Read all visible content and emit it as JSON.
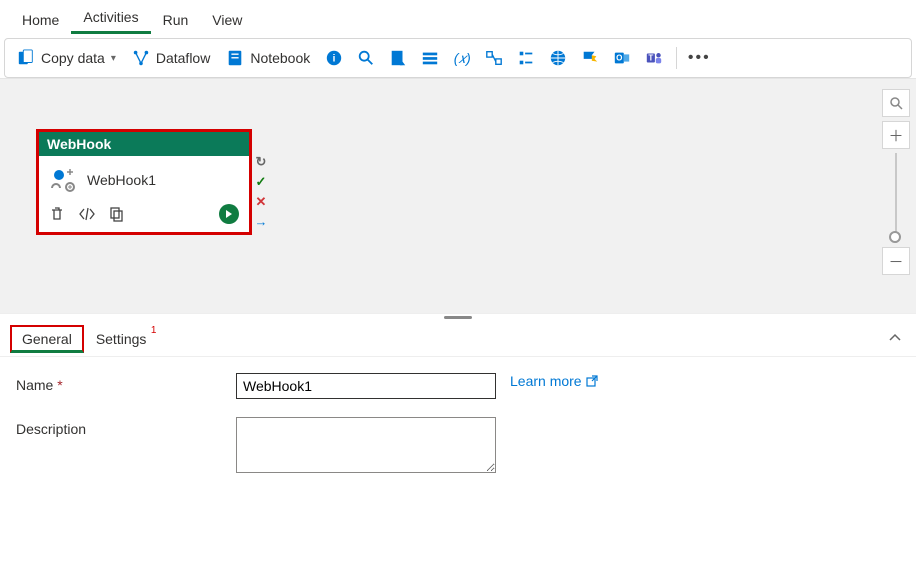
{
  "top_tabs": {
    "home": "Home",
    "activities": "Activities",
    "run": "Run",
    "view": "View"
  },
  "toolbar": {
    "copy_data": "Copy data",
    "dataflow": "Dataflow",
    "notebook": "Notebook"
  },
  "activity": {
    "type_label": "WebHook",
    "name": "WebHook1"
  },
  "panel_tabs": {
    "general": "General",
    "settings": "Settings",
    "settings_badge": "1"
  },
  "form": {
    "name_label": "Name",
    "name_value": "WebHook1",
    "desc_label": "Description",
    "desc_value": "",
    "learn_more": "Learn more"
  }
}
